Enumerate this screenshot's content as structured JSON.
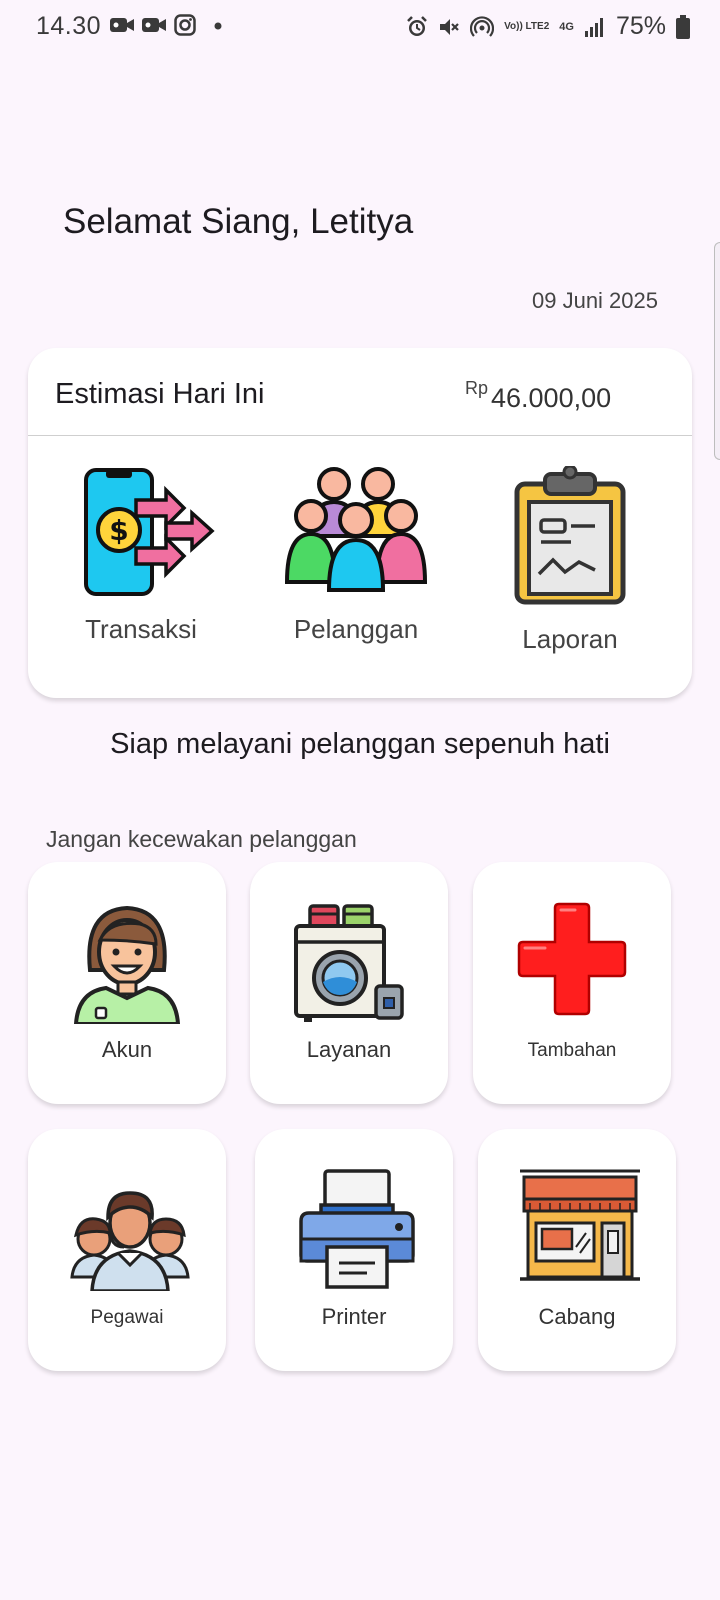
{
  "status_bar": {
    "time": "14.30",
    "battery": "75%",
    "left_icons": [
      "video-camera-icon",
      "video-camera-icon",
      "instagram-icon",
      "dot-icon"
    ],
    "right_icons": [
      "alarm-icon",
      "mute-icon",
      "hotspot-icon",
      "volte-icon",
      "4g-icon",
      "signal-icon",
      "battery-icon"
    ],
    "volte_label": "Vo)) LTE2",
    "network_label": "4G"
  },
  "greeting": "Selamat Siang, Letitya",
  "date": "09 Juni 2025",
  "summary": {
    "title": "Estimasi Hari Ini",
    "currency": "Rp",
    "amount": "46.000,00"
  },
  "quick_actions": [
    {
      "label": "Transaksi",
      "icon": "phone-money-transfer-icon"
    },
    {
      "label": "Pelanggan",
      "icon": "customers-group-icon"
    },
    {
      "label": "Laporan",
      "icon": "clipboard-report-icon"
    }
  ],
  "tagline": "Siap melayani pelanggan sepenuh hati",
  "subtitle": "Jangan kecewakan pelanggan",
  "menu": [
    {
      "label": "Akun",
      "icon": "user-avatar-icon"
    },
    {
      "label": "Layanan",
      "icon": "washing-machine-icon"
    },
    {
      "label": "Tambahan",
      "icon": "plus-cross-icon"
    },
    {
      "label": "Pegawai",
      "icon": "employees-icon"
    },
    {
      "label": "Printer",
      "icon": "printer-icon"
    },
    {
      "label": "Cabang",
      "icon": "store-branch-icon"
    }
  ],
  "colors": {
    "background": "#fcf5fd",
    "card": "#ffffff",
    "accent_cyan": "#1ec8f0",
    "accent_pink": "#f06fa0",
    "plus_red": "#ff2020"
  }
}
